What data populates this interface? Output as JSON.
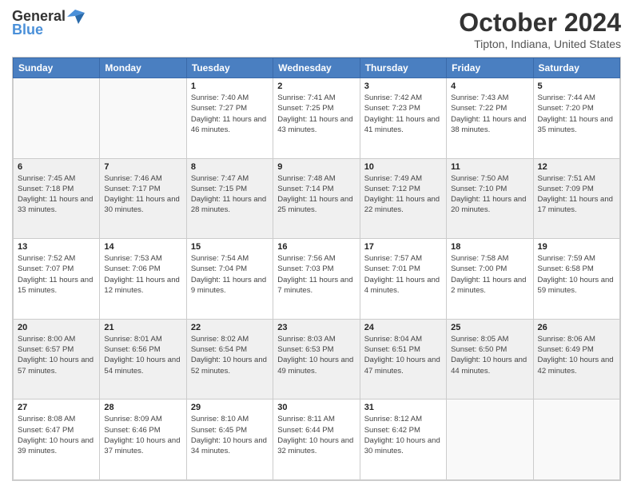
{
  "header": {
    "logo_general": "General",
    "logo_blue": "Blue",
    "title": "October 2024",
    "subtitle": "Tipton, Indiana, United States"
  },
  "calendar": {
    "days_of_week": [
      "Sunday",
      "Monday",
      "Tuesday",
      "Wednesday",
      "Thursday",
      "Friday",
      "Saturday"
    ],
    "weeks": [
      [
        {
          "day": "",
          "info": ""
        },
        {
          "day": "",
          "info": ""
        },
        {
          "day": "1",
          "info": "Sunrise: 7:40 AM\nSunset: 7:27 PM\nDaylight: 11 hours and 46 minutes."
        },
        {
          "day": "2",
          "info": "Sunrise: 7:41 AM\nSunset: 7:25 PM\nDaylight: 11 hours and 43 minutes."
        },
        {
          "day": "3",
          "info": "Sunrise: 7:42 AM\nSunset: 7:23 PM\nDaylight: 11 hours and 41 minutes."
        },
        {
          "day": "4",
          "info": "Sunrise: 7:43 AM\nSunset: 7:22 PM\nDaylight: 11 hours and 38 minutes."
        },
        {
          "day": "5",
          "info": "Sunrise: 7:44 AM\nSunset: 7:20 PM\nDaylight: 11 hours and 35 minutes."
        }
      ],
      [
        {
          "day": "6",
          "info": "Sunrise: 7:45 AM\nSunset: 7:18 PM\nDaylight: 11 hours and 33 minutes."
        },
        {
          "day": "7",
          "info": "Sunrise: 7:46 AM\nSunset: 7:17 PM\nDaylight: 11 hours and 30 minutes."
        },
        {
          "day": "8",
          "info": "Sunrise: 7:47 AM\nSunset: 7:15 PM\nDaylight: 11 hours and 28 minutes."
        },
        {
          "day": "9",
          "info": "Sunrise: 7:48 AM\nSunset: 7:14 PM\nDaylight: 11 hours and 25 minutes."
        },
        {
          "day": "10",
          "info": "Sunrise: 7:49 AM\nSunset: 7:12 PM\nDaylight: 11 hours and 22 minutes."
        },
        {
          "day": "11",
          "info": "Sunrise: 7:50 AM\nSunset: 7:10 PM\nDaylight: 11 hours and 20 minutes."
        },
        {
          "day": "12",
          "info": "Sunrise: 7:51 AM\nSunset: 7:09 PM\nDaylight: 11 hours and 17 minutes."
        }
      ],
      [
        {
          "day": "13",
          "info": "Sunrise: 7:52 AM\nSunset: 7:07 PM\nDaylight: 11 hours and 15 minutes."
        },
        {
          "day": "14",
          "info": "Sunrise: 7:53 AM\nSunset: 7:06 PM\nDaylight: 11 hours and 12 minutes."
        },
        {
          "day": "15",
          "info": "Sunrise: 7:54 AM\nSunset: 7:04 PM\nDaylight: 11 hours and 9 minutes."
        },
        {
          "day": "16",
          "info": "Sunrise: 7:56 AM\nSunset: 7:03 PM\nDaylight: 11 hours and 7 minutes."
        },
        {
          "day": "17",
          "info": "Sunrise: 7:57 AM\nSunset: 7:01 PM\nDaylight: 11 hours and 4 minutes."
        },
        {
          "day": "18",
          "info": "Sunrise: 7:58 AM\nSunset: 7:00 PM\nDaylight: 11 hours and 2 minutes."
        },
        {
          "day": "19",
          "info": "Sunrise: 7:59 AM\nSunset: 6:58 PM\nDaylight: 10 hours and 59 minutes."
        }
      ],
      [
        {
          "day": "20",
          "info": "Sunrise: 8:00 AM\nSunset: 6:57 PM\nDaylight: 10 hours and 57 minutes."
        },
        {
          "day": "21",
          "info": "Sunrise: 8:01 AM\nSunset: 6:56 PM\nDaylight: 10 hours and 54 minutes."
        },
        {
          "day": "22",
          "info": "Sunrise: 8:02 AM\nSunset: 6:54 PM\nDaylight: 10 hours and 52 minutes."
        },
        {
          "day": "23",
          "info": "Sunrise: 8:03 AM\nSunset: 6:53 PM\nDaylight: 10 hours and 49 minutes."
        },
        {
          "day": "24",
          "info": "Sunrise: 8:04 AM\nSunset: 6:51 PM\nDaylight: 10 hours and 47 minutes."
        },
        {
          "day": "25",
          "info": "Sunrise: 8:05 AM\nSunset: 6:50 PM\nDaylight: 10 hours and 44 minutes."
        },
        {
          "day": "26",
          "info": "Sunrise: 8:06 AM\nSunset: 6:49 PM\nDaylight: 10 hours and 42 minutes."
        }
      ],
      [
        {
          "day": "27",
          "info": "Sunrise: 8:08 AM\nSunset: 6:47 PM\nDaylight: 10 hours and 39 minutes."
        },
        {
          "day": "28",
          "info": "Sunrise: 8:09 AM\nSunset: 6:46 PM\nDaylight: 10 hours and 37 minutes."
        },
        {
          "day": "29",
          "info": "Sunrise: 8:10 AM\nSunset: 6:45 PM\nDaylight: 10 hours and 34 minutes."
        },
        {
          "day": "30",
          "info": "Sunrise: 8:11 AM\nSunset: 6:44 PM\nDaylight: 10 hours and 32 minutes."
        },
        {
          "day": "31",
          "info": "Sunrise: 8:12 AM\nSunset: 6:42 PM\nDaylight: 10 hours and 30 minutes."
        },
        {
          "day": "",
          "info": ""
        },
        {
          "day": "",
          "info": ""
        }
      ]
    ]
  }
}
